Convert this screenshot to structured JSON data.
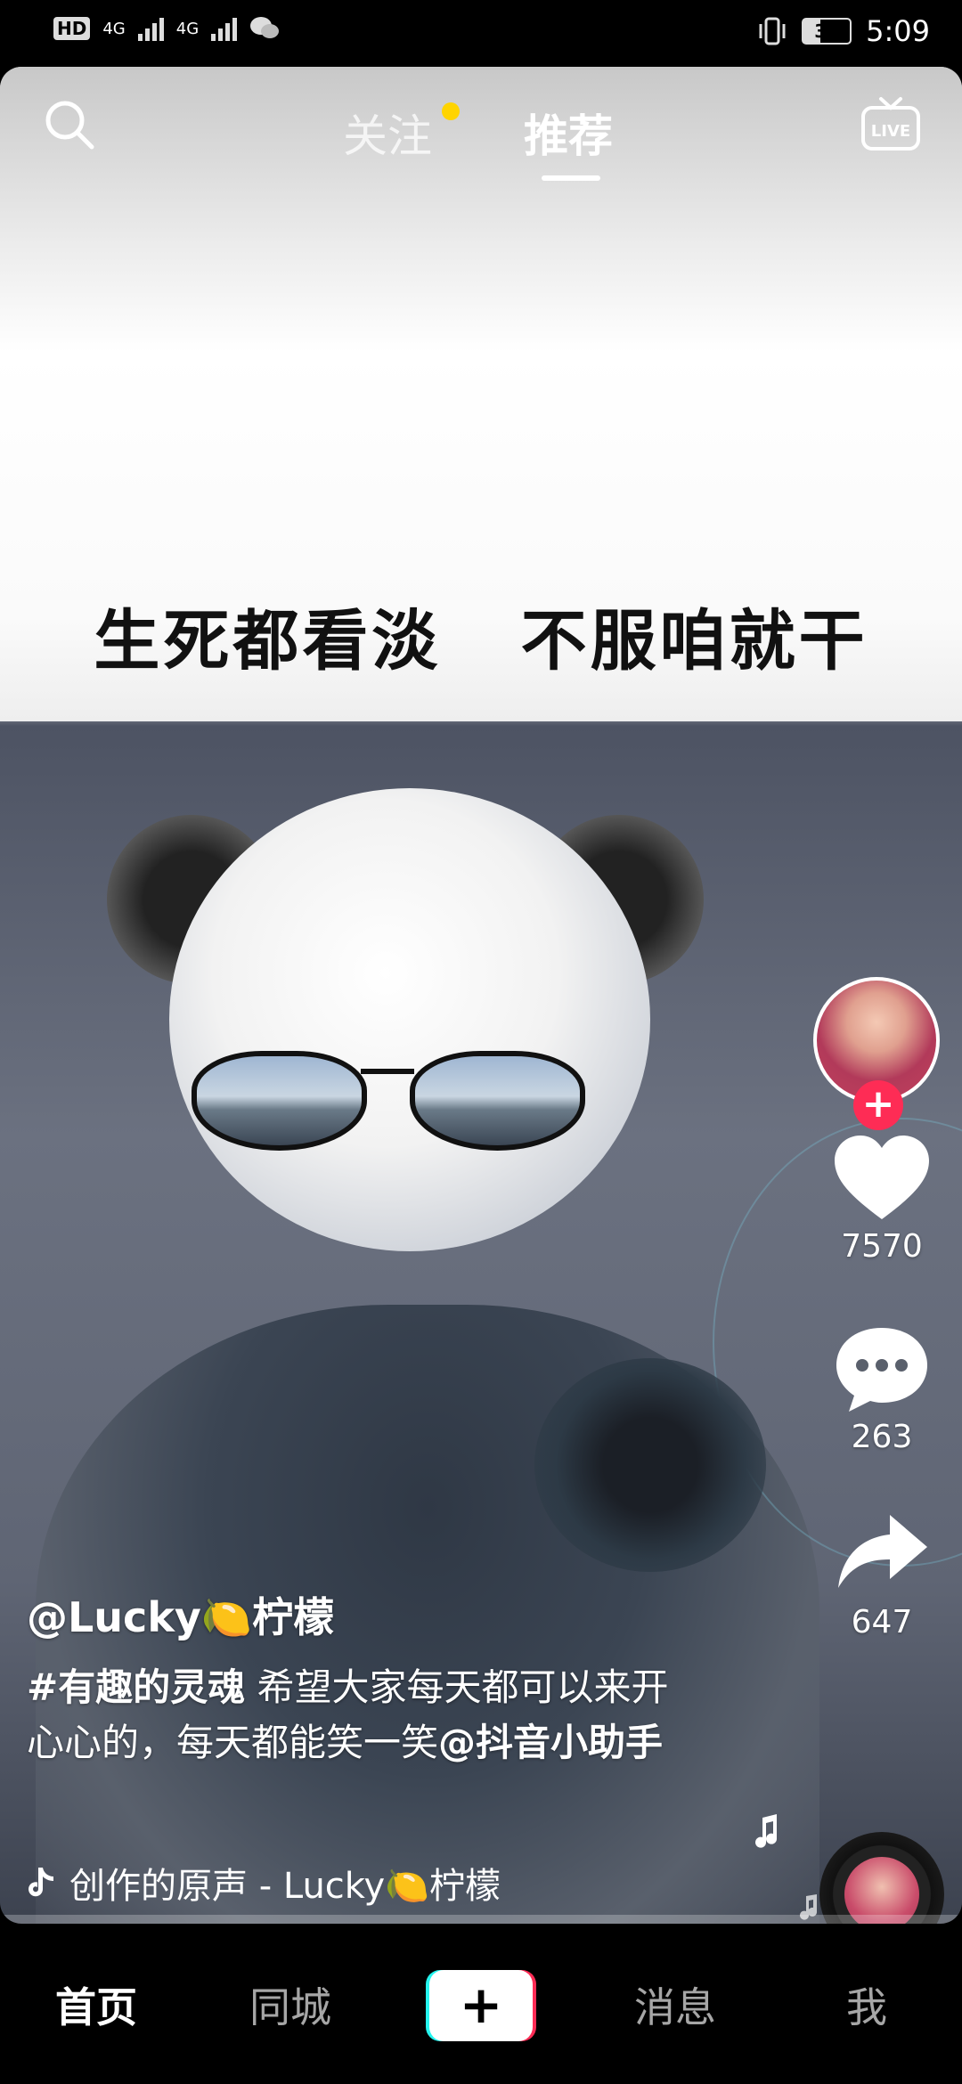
{
  "status_bar": {
    "hd_badge": "HD",
    "signal_label_1": "4G",
    "signal_label_2": "4G",
    "battery": "37",
    "time": "5:09"
  },
  "top_nav": {
    "tabs": [
      {
        "label": "关注",
        "active": false,
        "has_dot": true
      },
      {
        "label": "推荐",
        "active": true
      }
    ],
    "live_label": "LIVE",
    "icons": [
      "search-icon",
      "live-icon"
    ]
  },
  "video": {
    "overlay_text": "生死都看淡   不服咱就干"
  },
  "actions": {
    "like_count": "7570",
    "comment_count": "263",
    "share_count": "647",
    "follow_symbol": "+"
  },
  "caption": {
    "author": "@Lucky🍋柠檬",
    "hashtag": "#有趣的灵魂",
    "text": " 希望大家每天都可以来开心心的，每天都能笑一笑",
    "mention": "@抖音小助手",
    "music": "创作的原声 - Lucky🍋柠檬"
  },
  "bottom_nav": {
    "items": [
      {
        "label": "首页",
        "active": true
      },
      {
        "label": "同城",
        "active": false
      },
      {
        "label": "+",
        "active": false
      },
      {
        "label": "消息",
        "active": false
      },
      {
        "label": "我",
        "active": false
      }
    ]
  },
  "colors": {
    "accent_red": "#fe2c55",
    "accent_cyan": "#25f4ee",
    "notification_dot": "#ffd400"
  }
}
